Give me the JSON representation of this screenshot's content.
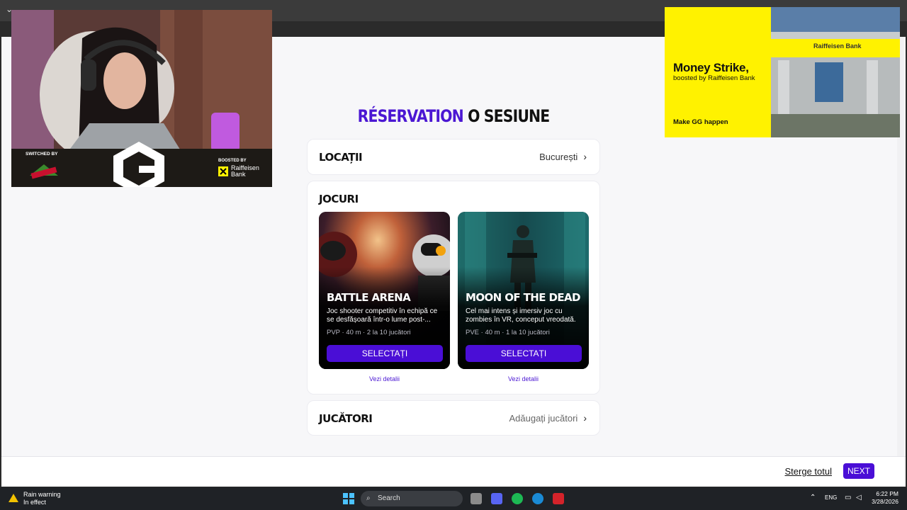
{
  "page": {
    "title_accent": "RÉSERVATION",
    "title_rest": "O SESIUNE",
    "location": {
      "label": "LOCAȚII",
      "value": "București"
    },
    "games_label": "JOCURI",
    "games": [
      {
        "name": "BATTLE ARENA",
        "description": "Joc shooter competitiv în echipă ce se desfășoară într-o lume post-...",
        "meta": "PVP · 40 m · 2 la 10 jucători",
        "select_label": "SELECTAȚI",
        "details_label": "Vezi detalii"
      },
      {
        "name": "MOON OF THE DEAD",
        "description": "Cel mai intens și imersiv joc cu zombies în VR, conceput vreodată.",
        "meta": "PVE · 40 m · 1 la 10 jucători",
        "select_label": "SELECTAȚI",
        "details_label": "Vezi detalii"
      }
    ],
    "players": {
      "label": "JUCĂTORI",
      "value": "Adăugați jucători"
    },
    "footer": {
      "clear_label": "Sterge totul",
      "next_label": "NEXT"
    }
  },
  "overlay": {
    "webcam": {
      "switched_by": "SWITCHED BY",
      "boosted_by": "BOOSTED BY",
      "raif": "Raiffeisen Bank"
    },
    "ad": {
      "title": "Money Strike,",
      "subtitle": "boosted by Raiffeisen Bank",
      "tagline": "Make GG happen",
      "sign": "Raiffeisen Bank"
    }
  },
  "taskbar": {
    "weather_title": "Rain warning",
    "weather_sub": "In effect",
    "search_label": "Search",
    "language": "ENG",
    "time": "6:22 PM",
    "date": "3/28/2026"
  },
  "colors": {
    "accent": "#4a0ed6",
    "ad_yellow": "#fff200"
  }
}
